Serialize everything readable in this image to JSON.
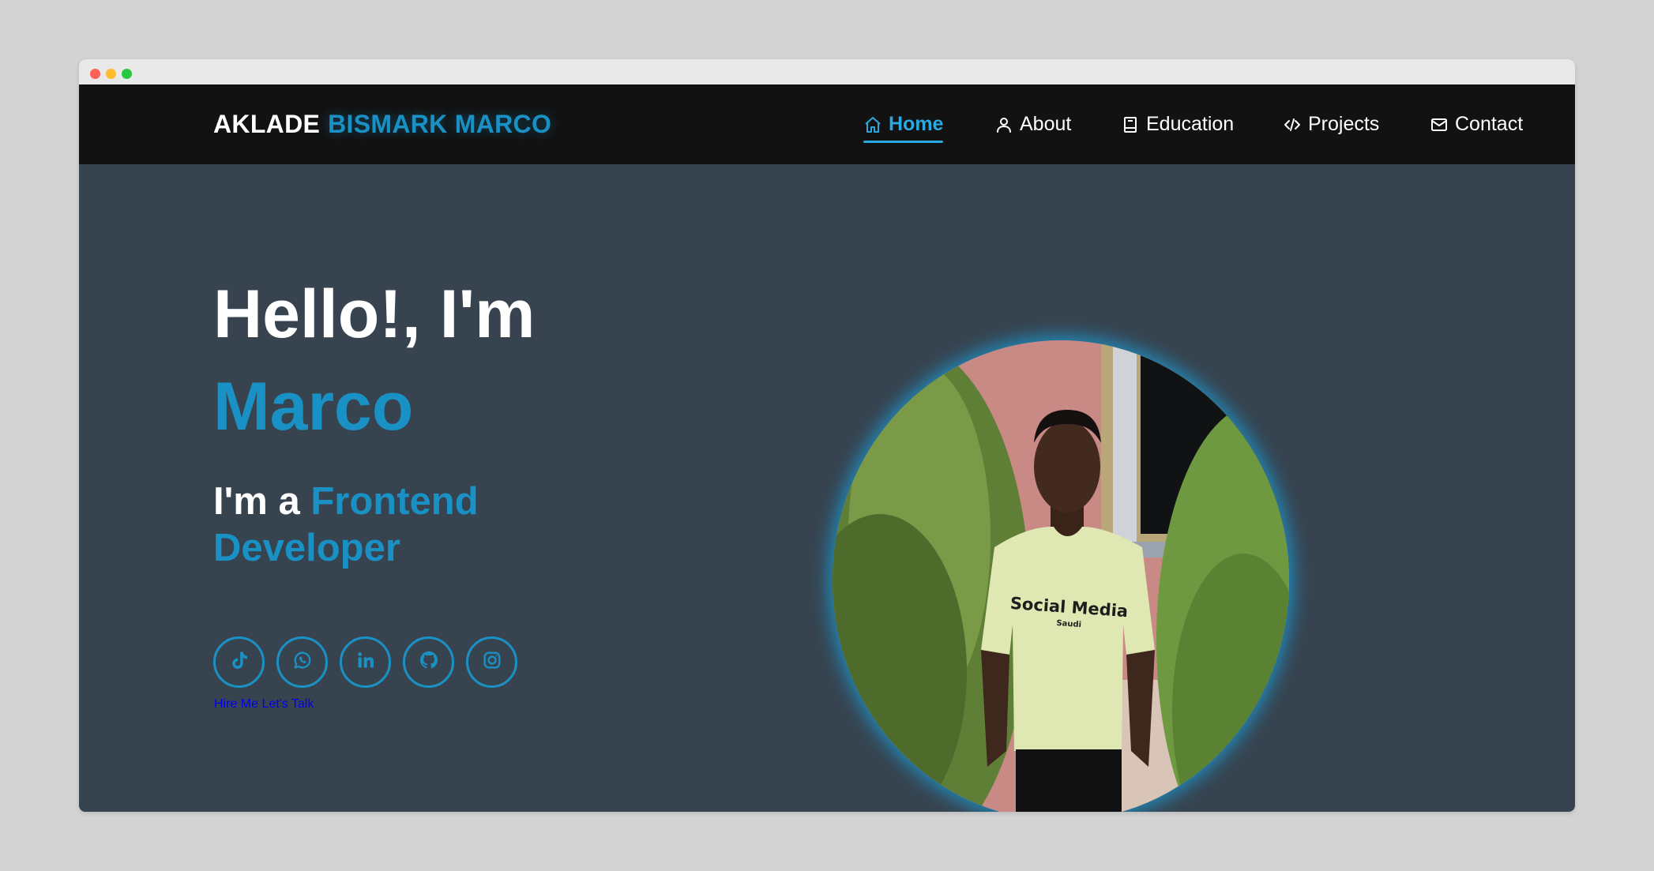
{
  "brand": {
    "first": "AKLADE",
    "last": "BISMARK MARCO"
  },
  "nav": {
    "items": [
      {
        "label": "Home",
        "icon": "home-icon",
        "active": true
      },
      {
        "label": "About",
        "icon": "user-icon",
        "active": false
      },
      {
        "label": "Education",
        "icon": "book-icon",
        "active": false
      },
      {
        "label": "Projects",
        "icon": "code-icon",
        "active": false
      },
      {
        "label": "Contact",
        "icon": "mail-icon",
        "active": false
      }
    ]
  },
  "hero": {
    "greeting": "Hello!, I'm",
    "name": "Marco",
    "role_prefix": "I'm a",
    "role_highlight": "Frontend Developer",
    "hire_link": "Hire Me Let's Talk",
    "socials": [
      "tiktok-icon",
      "whatsapp-icon",
      "linkedin-icon",
      "github-icon",
      "instagram-icon"
    ],
    "shirt_text": "Social Media",
    "shirt_subtext": "Saudi"
  },
  "colors": {
    "accent": "#1a91c5",
    "nav_active": "#2aa9e0",
    "navbar_bg": "#121212",
    "hero_bg": "#374450",
    "page_bg": "#d3d3d3"
  }
}
